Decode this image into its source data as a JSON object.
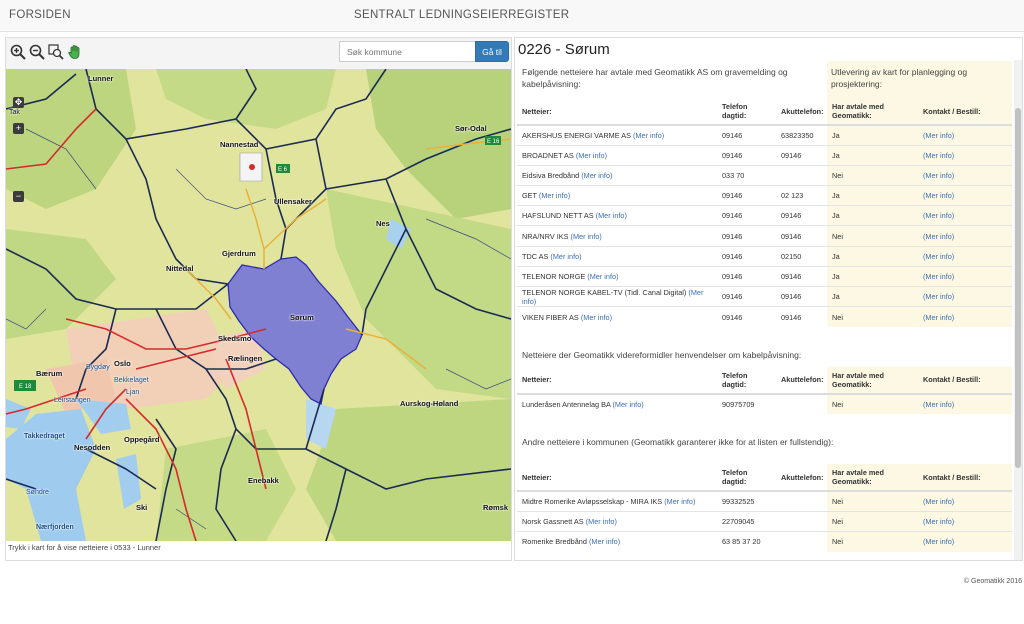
{
  "header": {
    "home_label": "FORSIDEN",
    "title": "SENTRALT LEDNINGSEIERREGISTER"
  },
  "map_toolbar": {
    "tools": [
      "zoom-in-icon",
      "zoom-out-icon",
      "zoom-extent-icon",
      "pan-hand-icon"
    ],
    "search_placeholder": "Søk kommune",
    "search_button": "Gå til"
  },
  "map": {
    "hint": "Trykk i kart for å vise netteiere i 0533 - Lunner",
    "zoom_controls": [
      "+",
      "−"
    ],
    "road_shields": [
      "E 6",
      "E 16",
      "E 18"
    ],
    "place_labels": [
      "Lunner",
      "Nannestad",
      "Ullensaker",
      "Sør-Odal",
      "Nes",
      "Gjerdrum",
      "Nittedal",
      "Sørum",
      "Skedsmo",
      "Rælingen",
      "Oslo",
      "Bærum",
      "Nesodden",
      "Oppegård",
      "Aurskog-Høland",
      "Enebakk",
      "Ski",
      "Rømsk",
      "Takkedraget",
      "Bygdøy",
      "Bekkelaget",
      "Leirstangen",
      "Ljan",
      "Søndre",
      "Nærfjorden",
      "Tak"
    ],
    "colors": {
      "land": "#dfe39a",
      "forest": "#b7d27a",
      "water": "#9cc9ee",
      "urban": "#f0c8b0",
      "selected": "#6f6fdc",
      "border": "#1b2a52",
      "road": "#d83030"
    }
  },
  "panel": {
    "title": "0226 - Sørum",
    "sections": [
      {
        "intro": "Følgende netteiere har avtale med Geomatikk AS om gravemelding og kabelpåvisning:",
        "yellow_note": "Utlevering av kart for planlegging og prosjektering:",
        "headers": [
          "Netteier:",
          "Telefon dagtid:",
          "Akuttelefon:",
          "Har avtale med Geomatikk:",
          "Kontakt / Bestill:"
        ],
        "rows": [
          {
            "name": "AKERSHUS ENERGI VARME AS",
            "info": "(Mer info)",
            "phone": "09146",
            "emergency": "63823350",
            "agreement": "Ja",
            "contact": "(Mer info)"
          },
          {
            "name": "BROADNET AS",
            "info": "(Mer info)",
            "phone": "09146",
            "emergency": "09146",
            "agreement": "Ja",
            "contact": "(Mer info)"
          },
          {
            "name": "Eidsiva Bredbånd",
            "info": "(Mer info)",
            "phone": "033 70",
            "emergency": "",
            "agreement": "Nei",
            "contact": "(Mer info)"
          },
          {
            "name": "GET",
            "info": "(Mer info)",
            "phone": "09146",
            "emergency": "02 123",
            "agreement": "Ja",
            "contact": "(Mer info)"
          },
          {
            "name": "HAFSLUND NETT AS",
            "info": "(Mer info)",
            "phone": "09146",
            "emergency": "09146",
            "agreement": "Ja",
            "contact": "(Mer info)"
          },
          {
            "name": "NRA/NRV IKS",
            "info": "(Mer info)",
            "phone": "09146",
            "emergency": "09146",
            "agreement": "Nei",
            "contact": "(Mer info)"
          },
          {
            "name": "TDC AS",
            "info": "(Mer info)",
            "phone": "09146",
            "emergency": "02150",
            "agreement": "Ja",
            "contact": "(Mer info)"
          },
          {
            "name": "TELENOR NORGE",
            "info": "(Mer info)",
            "phone": "09146",
            "emergency": "09146",
            "agreement": "Ja",
            "contact": "(Mer info)"
          },
          {
            "name": "TELENOR NORGE KABEL-TV (Tidl. Canal Digital)",
            "info": "(Mer info)",
            "phone": "09146",
            "emergency": "09146",
            "agreement": "Ja",
            "contact": "(Mer info)"
          },
          {
            "name": "VIKEN FIBER AS",
            "info": "(Mer info)",
            "phone": "09146",
            "emergency": "09146",
            "agreement": "Nei",
            "contact": "(Mer info)"
          }
        ]
      },
      {
        "intro": "Netteiere der Geomatikk videreformidler henvendelser om kabelpåvisning:",
        "headers": [
          "Netteier:",
          "Telefon dagtid:",
          "Akuttelefon:",
          "Har avtale med Geomatikk:",
          "Kontakt / Bestill:"
        ],
        "rows": [
          {
            "name": "Lunderåsen Antennelag BA",
            "info": "(Mer info)",
            "phone": "90975709",
            "emergency": "",
            "agreement": "Nei",
            "contact": "(Mer info)"
          }
        ]
      },
      {
        "intro": "Andre netteiere i kommunen (Geomatikk garanterer ikke for at listen er fullstendig):",
        "headers": [
          "Netteier:",
          "Telefon dagtid:",
          "Akuttelefon:",
          "Har avtale med Geomatikk:",
          "Kontakt / Bestill:"
        ],
        "rows": [
          {
            "name": "Midtre Romerike Avløpsselskap - MIRA IKS",
            "info": "(Mer info)",
            "phone": "99332525",
            "emergency": "",
            "agreement": "Nei",
            "contact": "(Mer info)"
          },
          {
            "name": "Norsk Gassnett AS",
            "info": "(Mer info)",
            "phone": "22709045",
            "emergency": "",
            "agreement": "Nei",
            "contact": "(Mer info)"
          },
          {
            "name": "Romerike Bredbånd",
            "info": "(Mer info)",
            "phone": "63 85 37 20",
            "emergency": "",
            "agreement": "Nei",
            "contact": "(Mer info)"
          }
        ]
      }
    ]
  },
  "footer": "© Geomatikk 2016"
}
